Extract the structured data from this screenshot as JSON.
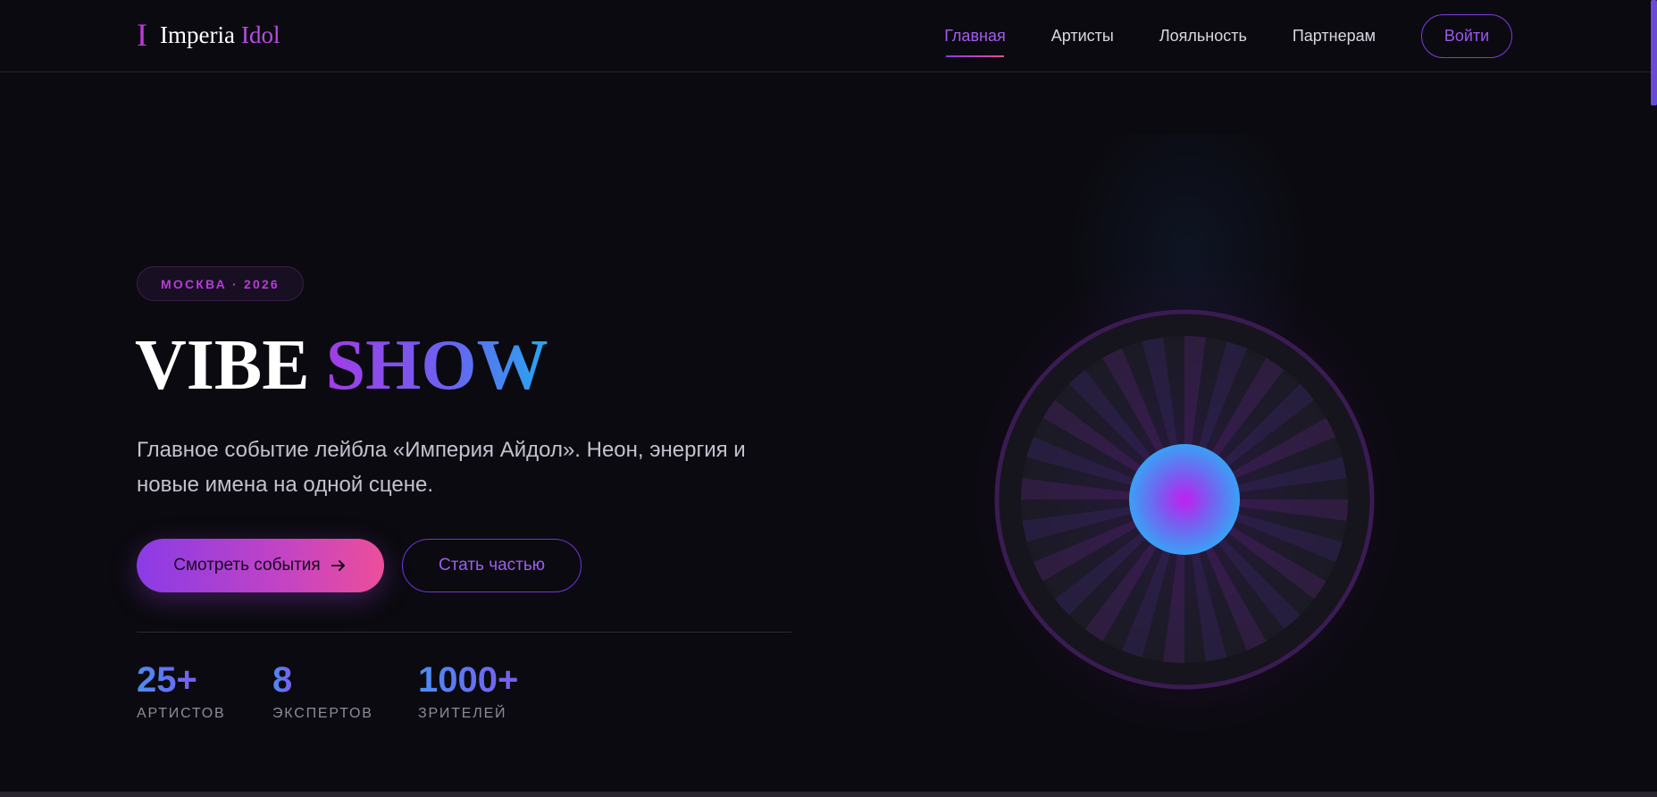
{
  "header": {
    "logo_mark": "I",
    "logo_word1": "Imperia",
    "logo_word2": "Idol",
    "nav": [
      {
        "label": "Главная",
        "active": true
      },
      {
        "label": "Артисты",
        "active": false
      },
      {
        "label": "Лояльность",
        "active": false
      },
      {
        "label": "Партнерам",
        "active": false
      }
    ],
    "login_label": "Войти"
  },
  "hero": {
    "badge": "МОСКВА · 2026",
    "title_part1": "VIBE",
    "title_part2": "SHOW",
    "description": "Главное событие лейбла «Империя Айдол». Неон, энергия и новые имена на одной сцене.",
    "primary_button": "Смотреть события",
    "secondary_button": "Стать частью",
    "stats": [
      {
        "value": "25+",
        "label": "АРТИСТОВ"
      },
      {
        "value": "8",
        "label": "ЭКСПЕРТОВ"
      },
      {
        "value": "1000+",
        "label": "ЗРИТЕЛЕЙ"
      }
    ]
  },
  "icons": {
    "arrow": "arrow-right-icon",
    "visual": "neon-disc-icon"
  },
  "colors": {
    "background": "#0b0a10",
    "accent_purple": "#8a3be6",
    "accent_pink": "#ec4e9a",
    "accent_blue": "#26a8f0"
  }
}
